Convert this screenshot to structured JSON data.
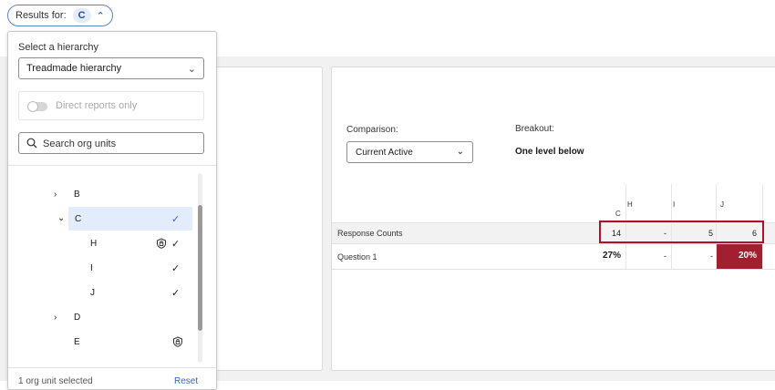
{
  "results_pill": {
    "label": "Results for:",
    "value": "C"
  },
  "panel": {
    "hierarchy_label": "Select a hierarchy",
    "hierarchy_value": "Treadmade hierarchy",
    "toggle_label": "Direct reports only",
    "search_placeholder": "Search org units",
    "tree": [
      {
        "name": "B",
        "expandable": true,
        "expanded": false,
        "checked": false
      },
      {
        "name": "C",
        "expandable": true,
        "expanded": true,
        "checked": true,
        "selected": true
      },
      {
        "name": "H",
        "locked": true,
        "checked": true
      },
      {
        "name": "I",
        "checked": true
      },
      {
        "name": "J",
        "checked": true
      },
      {
        "name": "D",
        "expandable": true,
        "expanded": false,
        "checked": false
      },
      {
        "name": "E",
        "locked": true,
        "checked": false
      }
    ],
    "footer_text": "1 org unit selected",
    "reset_label": "Reset"
  },
  "comparison": {
    "label": "Comparison:",
    "value": "Current Active"
  },
  "breakout": {
    "label": "Breakout:",
    "value": "One level below"
  },
  "table": {
    "columns": [
      "C",
      "H",
      "I",
      "J"
    ],
    "rows": [
      {
        "label": "Response Counts",
        "values": [
          "14",
          "-",
          "5",
          "6"
        ]
      },
      {
        "label": "Question 1",
        "values": [
          "27%",
          "-",
          "-",
          "20%"
        ]
      }
    ]
  },
  "colors": {
    "accent": "#2f66c8",
    "negative": "#a31e2e",
    "highlight_border": "#b0112a"
  }
}
